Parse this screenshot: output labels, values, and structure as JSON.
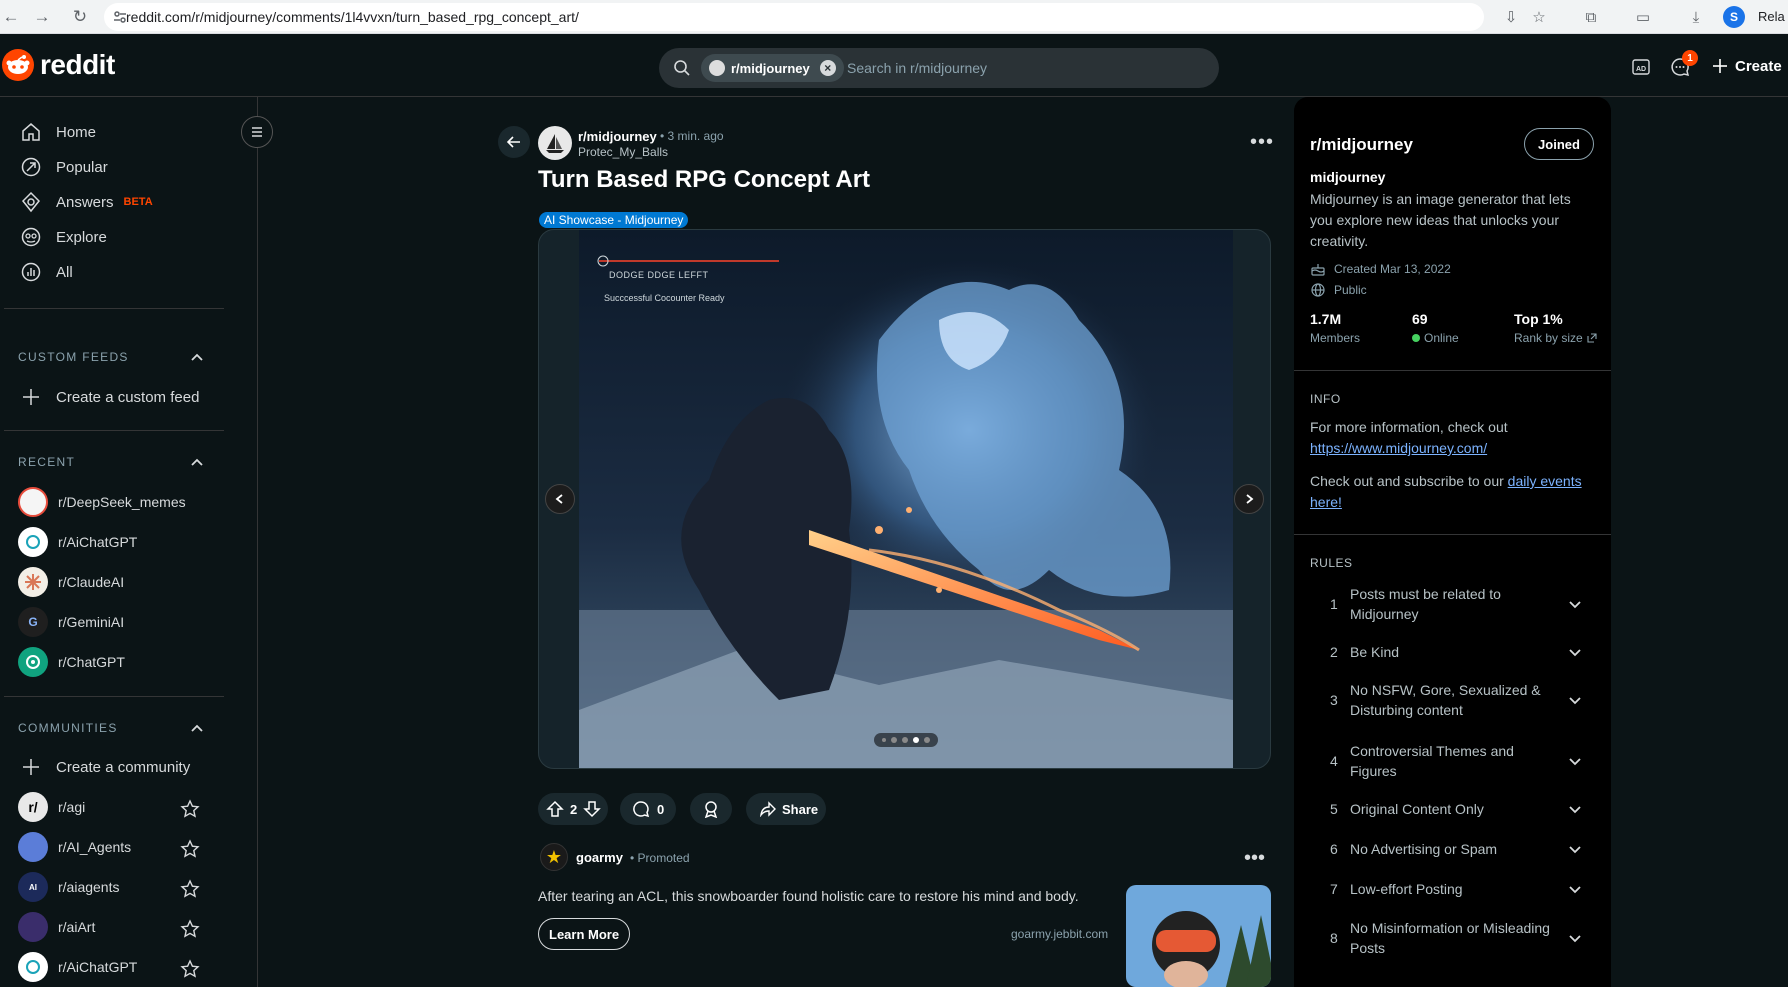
{
  "browser": {
    "url": "reddit.com/r/midjourney/comments/1l4vvxn/turn_based_rpg_concept_art/",
    "profile_initial": "S",
    "profile_label": "Rela"
  },
  "header": {
    "logo_text": "reddit",
    "search_chip": "r/midjourney",
    "search_placeholder": "Search in r/midjourney",
    "notification_count": "1",
    "create_label": "Create"
  },
  "left_nav": {
    "items": [
      {
        "label": "Home",
        "icon": "home-icon"
      },
      {
        "label": "Popular",
        "icon": "popular-icon"
      },
      {
        "label": "Answers",
        "icon": "answers-icon",
        "badge": "BETA"
      },
      {
        "label": "Explore",
        "icon": "explore-icon"
      },
      {
        "label": "All",
        "icon": "all-icon"
      }
    ],
    "custom_feeds_heading": "CUSTOM FEEDS",
    "create_feed_label": "Create a custom feed",
    "recent_heading": "RECENT",
    "recent": [
      "r/DeepSeek_memes",
      "r/AiChatGPT",
      "r/ClaudeAI",
      "r/GeminiAI",
      "r/ChatGPT"
    ],
    "communities_heading": "COMMUNITIES",
    "create_community_label": "Create a community",
    "communities": [
      "r/agi",
      "r/AI_Agents",
      "r/aiagents",
      "r/aiArt",
      "r/AiChatGPT"
    ]
  },
  "post": {
    "subreddit": "r/midjourney",
    "time": "• 3 min. ago",
    "author": "Protec_My_Balls",
    "title": "Turn Based RPG Concept Art",
    "flair": "AI Showcase - Midjourney",
    "gallery": {
      "hud_line1": "DODGE DDGE LEFFT",
      "hud_line2": "Succcessful Cocounter Ready",
      "slide_count": 5,
      "active_slide": 4
    },
    "votes": "2",
    "comments": "0",
    "share_label": "Share"
  },
  "promoted": {
    "name": "goarmy",
    "tag": "Promoted",
    "text": "After tearing an ACL, this snowboarder found holistic care to restore his mind and body.",
    "button": "Learn More",
    "domain": "goarmy.jebbit.com"
  },
  "community": {
    "title": "r/midjourney",
    "joined_label": "Joined",
    "name": "midjourney",
    "description": "Midjourney is an image generator that lets you explore new ideas that unlocks your creativity.",
    "created": "Created Mar 13, 2022",
    "visibility": "Public",
    "stats": [
      {
        "value": "1.7M",
        "label": "Members"
      },
      {
        "value": "69",
        "label": "Online"
      },
      {
        "value": "Top 1%",
        "label": "Rank by size"
      }
    ],
    "info_heading": "INFO",
    "info_text": "For more information, check out",
    "info_link": "https://www.midjourney.com/",
    "subscribe_text": "Check out and subscribe to our",
    "subscribe_link": "daily events here!",
    "rules_heading": "RULES",
    "rules": [
      {
        "num": "1",
        "text": "Posts must be related to Midjourney"
      },
      {
        "num": "2",
        "text": "Be Kind"
      },
      {
        "num": "3",
        "text": "No NSFW, Gore, Sexualized & Disturbing content"
      },
      {
        "num": "4",
        "text": "Controversial Themes and Figures"
      },
      {
        "num": "5",
        "text": "Original Content Only"
      },
      {
        "num": "6",
        "text": "No Advertising or Spam"
      },
      {
        "num": "7",
        "text": "Low-effort Posting"
      },
      {
        "num": "8",
        "text": "No Misinformation or Misleading Posts"
      }
    ]
  },
  "colors": {
    "brand": "#ff4500",
    "background": "#0b1416",
    "flair": "#0079d3",
    "link": "#7cb3ff"
  }
}
